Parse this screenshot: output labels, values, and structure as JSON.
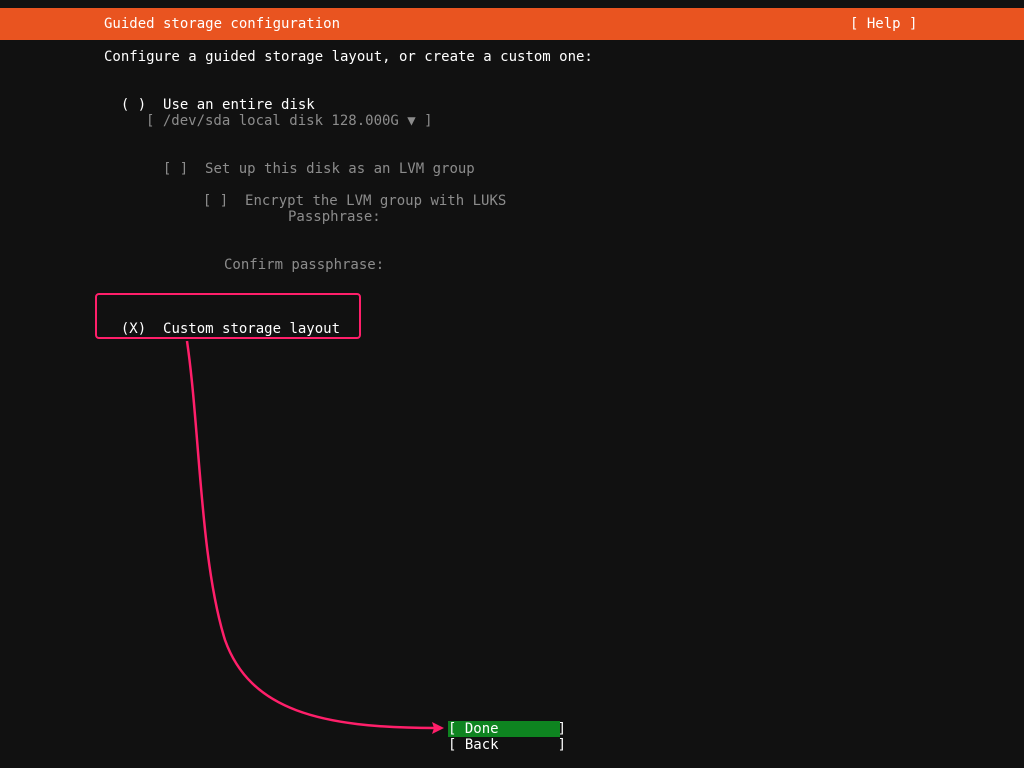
{
  "header": {
    "title": "Guided storage configuration",
    "help_label": "[ Help ]"
  },
  "intro": "Configure a guided storage layout, or create a custom one:",
  "option_entire_disk": {
    "radio": "( )",
    "label": "Use an entire disk"
  },
  "disk_select": {
    "value": "[ /dev/sda local disk 128.000G ▼ ]"
  },
  "lvm": {
    "checkbox": "[ ]",
    "label": "Set up this disk as an LVM group"
  },
  "luks": {
    "checkbox": "[ ]",
    "label": "Encrypt the LVM group with LUKS"
  },
  "passphrase_label": "Passphrase:",
  "confirm_passphrase_label": "Confirm passphrase:",
  "option_custom": {
    "radio": "(X)",
    "label": "Custom storage layout"
  },
  "buttons": {
    "done": "[ Done       ]",
    "back": "[ Back       ]"
  },
  "colors": {
    "accent": "#e95420",
    "selected_button": "#0e8420",
    "annotation": "#ff1f6a"
  }
}
